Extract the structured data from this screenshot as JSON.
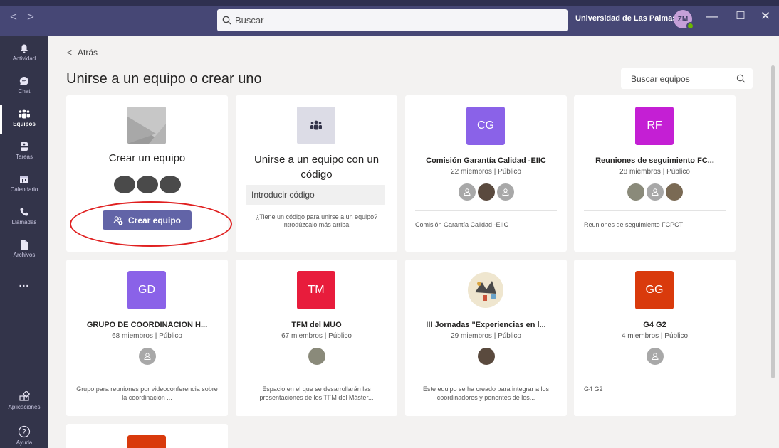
{
  "titlebar": {
    "search_placeholder": "Buscar",
    "org": "Universidad de Las Palmas...",
    "user_initials": "ZM"
  },
  "rail": [
    {
      "label": "Actividad",
      "icon": "bell-icon"
    },
    {
      "label": "Chat",
      "icon": "chat-icon"
    },
    {
      "label": "Equipos",
      "icon": "teams-icon"
    },
    {
      "label": "Tareas",
      "icon": "tasks-icon"
    },
    {
      "label": "Calendario",
      "icon": "calendar-icon"
    },
    {
      "label": "Llamadas",
      "icon": "phone-icon"
    },
    {
      "label": "Archivos",
      "icon": "file-icon"
    },
    {
      "label": "...",
      "icon": "more-icon"
    },
    {
      "label": "Aplicaciones",
      "icon": "apps-icon"
    },
    {
      "label": "Ayuda",
      "icon": "help-icon"
    }
  ],
  "back_label": "Atrás",
  "page_title": "Unirse a un equipo o crear uno",
  "team_search_placeholder": "Buscar equipos",
  "create": {
    "title": "Crear un equipo",
    "button": "Crear equipo"
  },
  "join": {
    "title": "Unirse a un equipo con un código",
    "input_placeholder": "Introducir código",
    "help": "¿Tiene un código para unirse a un equipo? Introdúzcalo más arriba."
  },
  "teams": [
    {
      "initials": "CG",
      "color": "#8a62e8",
      "name": "Comisión Garantía Calidad -EIIC",
      "meta": "22 miembros | Público",
      "desc": "Comisión Garantía Calidad -EIIC"
    },
    {
      "initials": "RF",
      "color": "#c41fd4",
      "name": "Reuniones de seguimiento FC...",
      "meta": "28 miembros | Público",
      "desc": "Reuniones de seguimiento FCPCT"
    },
    {
      "initials": "GD",
      "color": "#8a62e8",
      "name": "GRUPO DE COORDINACIÓN H...",
      "meta": "68 miembros | Público",
      "desc": "Grupo para reuniones por videoconferencia sobre la coordinación ..."
    },
    {
      "initials": "TM",
      "color": "#e81c3c",
      "name": "TFM del MUO",
      "meta": "67 miembros | Público",
      "desc": "Espacio en el que se desarrollarán las presentaciones de los TFM del Máster..."
    },
    {
      "initials": "",
      "color": "#ffffff",
      "name": "III Jornadas \"Experiencias en l...",
      "meta": "29 miembros | Público",
      "desc": "Este equipo se ha creado para integrar a los coordinadores y ponentes de los..."
    },
    {
      "initials": "GG",
      "color": "#d93a0c",
      "name": "G4 G2",
      "meta": "4 miembros | Público",
      "desc": "G4 G2"
    }
  ]
}
